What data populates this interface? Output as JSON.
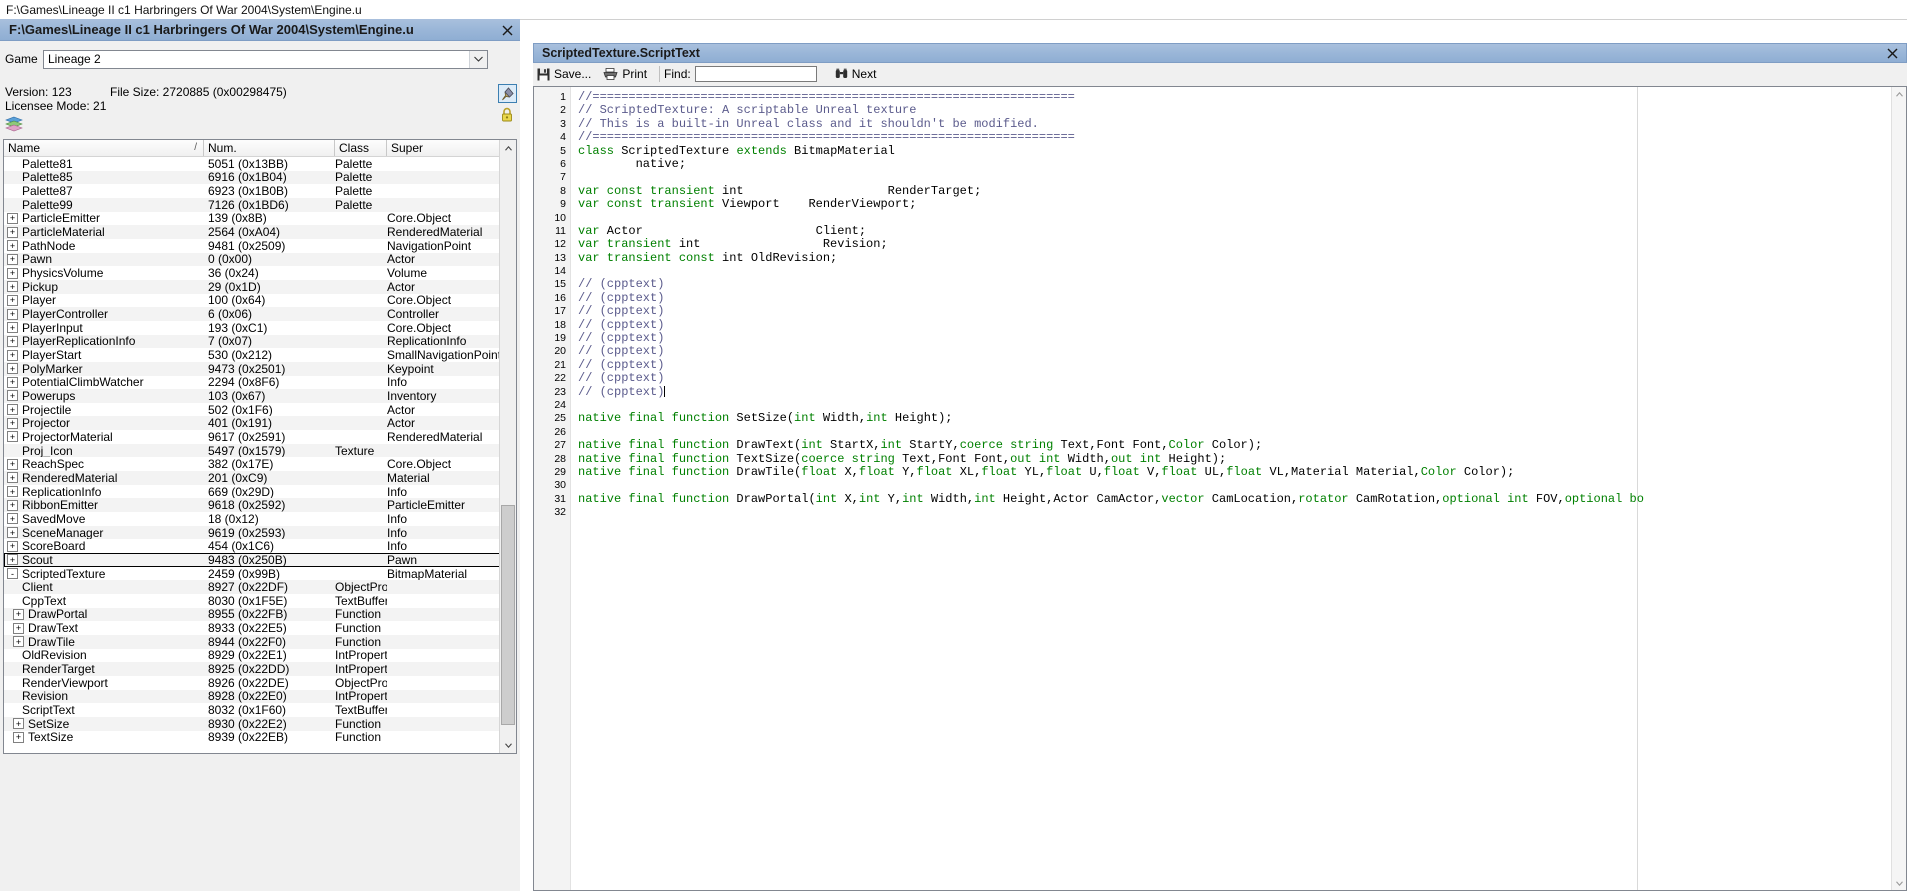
{
  "os_tab": {
    "title": "F:\\Games\\Lineage II c1 Harbringers Of War 2004\\System\\Engine.u"
  },
  "left_window": {
    "title": "F:\\Games\\Lineage II c1 Harbringers Of War 2004\\System\\Engine.u",
    "close_label": "✕",
    "game_label": "Game",
    "game_value": "Lineage 2",
    "chevron": "∨",
    "version_line": "Version: 123",
    "filesize_line": "File Size: 2720885 (0x00298475)",
    "licensee_line": "Licensee Mode: 21"
  },
  "tree": {
    "columns": [
      {
        "label": "Name",
        "sort": "/"
      },
      {
        "label": "Num.",
        "sort": ""
      },
      {
        "label": "Class",
        "sort": ""
      },
      {
        "label": "Super",
        "sort": ""
      }
    ],
    "rows": [
      {
        "name": "Palette81",
        "num": "5051 (0x13BB)",
        "class": "Palette",
        "super": "",
        "exp": "",
        "indent": 0
      },
      {
        "name": "Palette85",
        "num": "6916 (0x1B04)",
        "class": "Palette",
        "super": "",
        "exp": "",
        "indent": 0
      },
      {
        "name": "Palette87",
        "num": "6923 (0x1B0B)",
        "class": "Palette",
        "super": "",
        "exp": "",
        "indent": 0
      },
      {
        "name": "Palette99",
        "num": "7126 (0x1BD6)",
        "class": "Palette",
        "super": "",
        "exp": "",
        "indent": 0
      },
      {
        "name": "ParticleEmitter",
        "num": "139 (0x8B)",
        "class": "",
        "super": "Core.Object",
        "exp": "+",
        "indent": 0
      },
      {
        "name": "ParticleMaterial",
        "num": "2564 (0xA04)",
        "class": "",
        "super": "RenderedMaterial",
        "exp": "+",
        "indent": 0
      },
      {
        "name": "PathNode",
        "num": "9481 (0x2509)",
        "class": "",
        "super": "NavigationPoint",
        "exp": "+",
        "indent": 0
      },
      {
        "name": "Pawn",
        "num": "0 (0x00)",
        "class": "",
        "super": "Actor",
        "exp": "+",
        "indent": 0
      },
      {
        "name": "PhysicsVolume",
        "num": "36 (0x24)",
        "class": "",
        "super": "Volume",
        "exp": "+",
        "indent": 0
      },
      {
        "name": "Pickup",
        "num": "29 (0x1D)",
        "class": "",
        "super": "Actor",
        "exp": "+",
        "indent": 0
      },
      {
        "name": "Player",
        "num": "100 (0x64)",
        "class": "",
        "super": "Core.Object",
        "exp": "+",
        "indent": 0
      },
      {
        "name": "PlayerController",
        "num": "6 (0x06)",
        "class": "",
        "super": "Controller",
        "exp": "+",
        "indent": 0
      },
      {
        "name": "PlayerInput",
        "num": "193 (0xC1)",
        "class": "",
        "super": "Core.Object",
        "exp": "+",
        "indent": 0
      },
      {
        "name": "PlayerReplicationInfo",
        "num": "7 (0x07)",
        "class": "",
        "super": "ReplicationInfo",
        "exp": "+",
        "indent": 0
      },
      {
        "name": "PlayerStart",
        "num": "530 (0x212)",
        "class": "",
        "super": "SmallNavigationPoint",
        "exp": "+",
        "indent": 0
      },
      {
        "name": "PolyMarker",
        "num": "9473 (0x2501)",
        "class": "",
        "super": "Keypoint",
        "exp": "+",
        "indent": 0
      },
      {
        "name": "PotentialClimbWatcher",
        "num": "2294 (0x8F6)",
        "class": "",
        "super": "Info",
        "exp": "+",
        "indent": 0
      },
      {
        "name": "Powerups",
        "num": "103 (0x67)",
        "class": "",
        "super": "Inventory",
        "exp": "+",
        "indent": 0
      },
      {
        "name": "Projectile",
        "num": "502 (0x1F6)",
        "class": "",
        "super": "Actor",
        "exp": "+",
        "indent": 0
      },
      {
        "name": "Projector",
        "num": "401 (0x191)",
        "class": "",
        "super": "Actor",
        "exp": "+",
        "indent": 0
      },
      {
        "name": "ProjectorMaterial",
        "num": "9617 (0x2591)",
        "class": "",
        "super": "RenderedMaterial",
        "exp": "+",
        "indent": 0
      },
      {
        "name": "Proj_Icon",
        "num": "5497 (0x1579)",
        "class": "Texture",
        "super": "",
        "exp": "",
        "indent": 0
      },
      {
        "name": "ReachSpec",
        "num": "382 (0x17E)",
        "class": "",
        "super": "Core.Object",
        "exp": "+",
        "indent": 0
      },
      {
        "name": "RenderedMaterial",
        "num": "201 (0xC9)",
        "class": "",
        "super": "Material",
        "exp": "+",
        "indent": 0
      },
      {
        "name": "ReplicationInfo",
        "num": "669 (0x29D)",
        "class": "",
        "super": "Info",
        "exp": "+",
        "indent": 0
      },
      {
        "name": "RibbonEmitter",
        "num": "9618 (0x2592)",
        "class": "",
        "super": "ParticleEmitter",
        "exp": "+",
        "indent": 0
      },
      {
        "name": "SavedMove",
        "num": "18 (0x12)",
        "class": "",
        "super": "Info",
        "exp": "+",
        "indent": 0
      },
      {
        "name": "SceneManager",
        "num": "9619 (0x2593)",
        "class": "",
        "super": "Info",
        "exp": "+",
        "indent": 0
      },
      {
        "name": "ScoreBoard",
        "num": "454 (0x1C6)",
        "class": "",
        "super": "Info",
        "exp": "+",
        "indent": 0
      },
      {
        "name": "Scout",
        "num": "9483 (0x250B)",
        "class": "",
        "super": "Pawn",
        "exp": "+",
        "indent": 0,
        "focused": true
      },
      {
        "name": "ScriptedTexture",
        "num": "2459 (0x99B)",
        "class": "",
        "super": "BitmapMaterial",
        "exp": "-",
        "indent": 0
      },
      {
        "name": "Client",
        "num": "8927 (0x22DF)",
        "class": "ObjectProperty",
        "super": "",
        "exp": "",
        "indent": 1
      },
      {
        "name": "CppText",
        "num": "8030 (0x1F5E)",
        "class": "TextBuffer",
        "super": "",
        "exp": "",
        "indent": 1
      },
      {
        "name": "DrawPortal",
        "num": "8955 (0x22FB)",
        "class": "Function",
        "super": "",
        "exp": "+",
        "indent": 1
      },
      {
        "name": "DrawText",
        "num": "8933 (0x22E5)",
        "class": "Function",
        "super": "",
        "exp": "+",
        "indent": 1
      },
      {
        "name": "DrawTile",
        "num": "8944 (0x22F0)",
        "class": "Function",
        "super": "",
        "exp": "+",
        "indent": 1
      },
      {
        "name": "OldRevision",
        "num": "8929 (0x22E1)",
        "class": "IntProperty",
        "super": "",
        "exp": "",
        "indent": 1
      },
      {
        "name": "RenderTarget",
        "num": "8925 (0x22DD)",
        "class": "IntProperty",
        "super": "",
        "exp": "",
        "indent": 1
      },
      {
        "name": "RenderViewport",
        "num": "8926 (0x22DE)",
        "class": "ObjectProperty",
        "super": "",
        "exp": "",
        "indent": 1
      },
      {
        "name": "Revision",
        "num": "8928 (0x22E0)",
        "class": "IntProperty",
        "super": "",
        "exp": "",
        "indent": 1
      },
      {
        "name": "ScriptText",
        "num": "8032 (0x1F60)",
        "class": "TextBuffer",
        "super": "",
        "exp": "",
        "indent": 1
      },
      {
        "name": "SetSize",
        "num": "8930 (0x22E2)",
        "class": "Function",
        "super": "",
        "exp": "+",
        "indent": 1
      },
      {
        "name": "TextSize",
        "num": "8939 (0x22EB)",
        "class": "Function",
        "super": "",
        "exp": "+",
        "indent": 1
      }
    ]
  },
  "right_window": {
    "title": "ScriptedTexture.ScriptText",
    "close_label": "✕",
    "toolbar": {
      "save_label": "Save...",
      "print_label": "Print",
      "find_label": "Find:",
      "find_value": "",
      "next_label": "Next"
    },
    "code_lines": [
      {
        "n": 1,
        "tokens": [
          {
            "t": "//===================================================================",
            "c": "cm"
          }
        ]
      },
      {
        "n": 2,
        "tokens": [
          {
            "t": "// ScriptedTexture: A scriptable Unreal texture",
            "c": "cm"
          }
        ]
      },
      {
        "n": 3,
        "tokens": [
          {
            "t": "// This is a built-in Unreal class and it shouldn't be modified.",
            "c": "cm"
          }
        ]
      },
      {
        "n": 4,
        "tokens": [
          {
            "t": "//===================================================================",
            "c": "cm"
          }
        ]
      },
      {
        "n": 5,
        "tokens": [
          {
            "t": "class",
            "c": "kw"
          },
          {
            "t": " ScriptedTexture ",
            "c": "pn"
          },
          {
            "t": "extends",
            "c": "kw"
          },
          {
            "t": " BitmapMaterial",
            "c": "pn"
          }
        ]
      },
      {
        "n": 6,
        "tokens": [
          {
            "t": "        native;",
            "c": "pn"
          }
        ]
      },
      {
        "n": 7,
        "tokens": [
          {
            "t": "",
            "c": "pn"
          }
        ]
      },
      {
        "n": 8,
        "tokens": [
          {
            "t": "var const transient",
            "c": "kw"
          },
          {
            "t": " int                    RenderTarget;",
            "c": "pn"
          }
        ]
      },
      {
        "n": 9,
        "tokens": [
          {
            "t": "var const transient",
            "c": "kw"
          },
          {
            "t": " Viewport    RenderViewport;",
            "c": "pn"
          }
        ]
      },
      {
        "n": 10,
        "tokens": [
          {
            "t": "",
            "c": "pn"
          }
        ]
      },
      {
        "n": 11,
        "tokens": [
          {
            "t": "var",
            "c": "kw"
          },
          {
            "t": " Actor                        Client;",
            "c": "pn"
          }
        ]
      },
      {
        "n": 12,
        "tokens": [
          {
            "t": "var transient",
            "c": "kw"
          },
          {
            "t": " int                 Revision;",
            "c": "pn"
          }
        ]
      },
      {
        "n": 13,
        "tokens": [
          {
            "t": "var transient const",
            "c": "kw"
          },
          {
            "t": " int OldRevision;",
            "c": "pn"
          }
        ]
      },
      {
        "n": 14,
        "tokens": [
          {
            "t": "",
            "c": "pn"
          }
        ]
      },
      {
        "n": 15,
        "tokens": [
          {
            "t": "// (cpptext)",
            "c": "cm"
          }
        ]
      },
      {
        "n": 16,
        "tokens": [
          {
            "t": "// (cpptext)",
            "c": "cm"
          }
        ]
      },
      {
        "n": 17,
        "tokens": [
          {
            "t": "// (cpptext)",
            "c": "cm"
          }
        ]
      },
      {
        "n": 18,
        "tokens": [
          {
            "t": "// (cpptext)",
            "c": "cm"
          }
        ]
      },
      {
        "n": 19,
        "tokens": [
          {
            "t": "// (cpptext)",
            "c": "cm"
          }
        ]
      },
      {
        "n": 20,
        "tokens": [
          {
            "t": "// (cpptext)",
            "c": "cm"
          }
        ]
      },
      {
        "n": 21,
        "tokens": [
          {
            "t": "// (cpptext)",
            "c": "cm"
          }
        ]
      },
      {
        "n": 22,
        "tokens": [
          {
            "t": "// (cpptext)",
            "c": "cm"
          }
        ]
      },
      {
        "n": 23,
        "tokens": [
          {
            "t": "// (cpptext)",
            "c": "cm"
          },
          {
            "t": "|CURSOR|",
            "c": "cur"
          }
        ]
      },
      {
        "n": 24,
        "tokens": [
          {
            "t": "",
            "c": "pn"
          }
        ]
      },
      {
        "n": 25,
        "tokens": [
          {
            "t": "native final function",
            "c": "kw"
          },
          {
            "t": " SetSize(",
            "c": "pn"
          },
          {
            "t": "int",
            "c": "kw"
          },
          {
            "t": " Width,",
            "c": "pn"
          },
          {
            "t": "int",
            "c": "kw"
          },
          {
            "t": " Height);",
            "c": "pn"
          }
        ]
      },
      {
        "n": 26,
        "tokens": [
          {
            "t": "",
            "c": "pn"
          }
        ]
      },
      {
        "n": 27,
        "tokens": [
          {
            "t": "native final function",
            "c": "kw"
          },
          {
            "t": " DrawText(",
            "c": "pn"
          },
          {
            "t": "int",
            "c": "kw"
          },
          {
            "t": " StartX,",
            "c": "pn"
          },
          {
            "t": "int",
            "c": "kw"
          },
          {
            "t": " StartY,",
            "c": "pn"
          },
          {
            "t": "coerce string",
            "c": "kw"
          },
          {
            "t": " Text,Font Font,",
            "c": "pn"
          },
          {
            "t": "Color",
            "c": "kw"
          },
          {
            "t": " Color);",
            "c": "pn"
          }
        ]
      },
      {
        "n": 28,
        "tokens": [
          {
            "t": "native final function",
            "c": "kw"
          },
          {
            "t": " TextSize(",
            "c": "pn"
          },
          {
            "t": "coerce string",
            "c": "kw"
          },
          {
            "t": " Text,Font Font,",
            "c": "pn"
          },
          {
            "t": "out int",
            "c": "kw"
          },
          {
            "t": " Width,",
            "c": "pn"
          },
          {
            "t": "out int",
            "c": "kw"
          },
          {
            "t": " Height);",
            "c": "pn"
          }
        ]
      },
      {
        "n": 29,
        "tokens": [
          {
            "t": "native final function",
            "c": "kw"
          },
          {
            "t": " DrawTile(",
            "c": "pn"
          },
          {
            "t": "float",
            "c": "kw"
          },
          {
            "t": " X,",
            "c": "pn"
          },
          {
            "t": "float",
            "c": "kw"
          },
          {
            "t": " Y,",
            "c": "pn"
          },
          {
            "t": "float",
            "c": "kw"
          },
          {
            "t": " XL,",
            "c": "pn"
          },
          {
            "t": "float",
            "c": "kw"
          },
          {
            "t": " YL,",
            "c": "pn"
          },
          {
            "t": "float",
            "c": "kw"
          },
          {
            "t": " U,",
            "c": "pn"
          },
          {
            "t": "float",
            "c": "kw"
          },
          {
            "t": " V,",
            "c": "pn"
          },
          {
            "t": "float",
            "c": "kw"
          },
          {
            "t": " UL,",
            "c": "pn"
          },
          {
            "t": "float",
            "c": "kw"
          },
          {
            "t": " VL,Material Material,",
            "c": "pn"
          },
          {
            "t": "Color",
            "c": "kw"
          },
          {
            "t": " Color);",
            "c": "pn"
          }
        ]
      },
      {
        "n": 30,
        "tokens": [
          {
            "t": "",
            "c": "pn"
          }
        ]
      },
      {
        "n": 31,
        "tokens": [
          {
            "t": "native final function",
            "c": "kw"
          },
          {
            "t": " DrawPortal(",
            "c": "pn"
          },
          {
            "t": "int",
            "c": "kw"
          },
          {
            "t": " X,",
            "c": "pn"
          },
          {
            "t": "int",
            "c": "kw"
          },
          {
            "t": " Y,",
            "c": "pn"
          },
          {
            "t": "int",
            "c": "kw"
          },
          {
            "t": " Width,",
            "c": "pn"
          },
          {
            "t": "int",
            "c": "kw"
          },
          {
            "t": " Height,Actor CamActor,",
            "c": "pn"
          },
          {
            "t": "vector",
            "c": "kw"
          },
          {
            "t": " CamLocation,",
            "c": "pn"
          },
          {
            "t": "rotator",
            "c": "kw"
          },
          {
            "t": " CamRotation,",
            "c": "pn"
          },
          {
            "t": "optional int",
            "c": "kw"
          },
          {
            "t": " FOV,",
            "c": "pn"
          },
          {
            "t": "optional bo",
            "c": "kw"
          }
        ]
      },
      {
        "n": 32,
        "tokens": [
          {
            "t": "",
            "c": "pn"
          }
        ]
      }
    ]
  },
  "colors": {
    "caption_blue": "#9ab6d8",
    "keyword_green": "#008000",
    "comment_slate": "#5b5b8c",
    "row_alt": "#f3f3f3"
  }
}
